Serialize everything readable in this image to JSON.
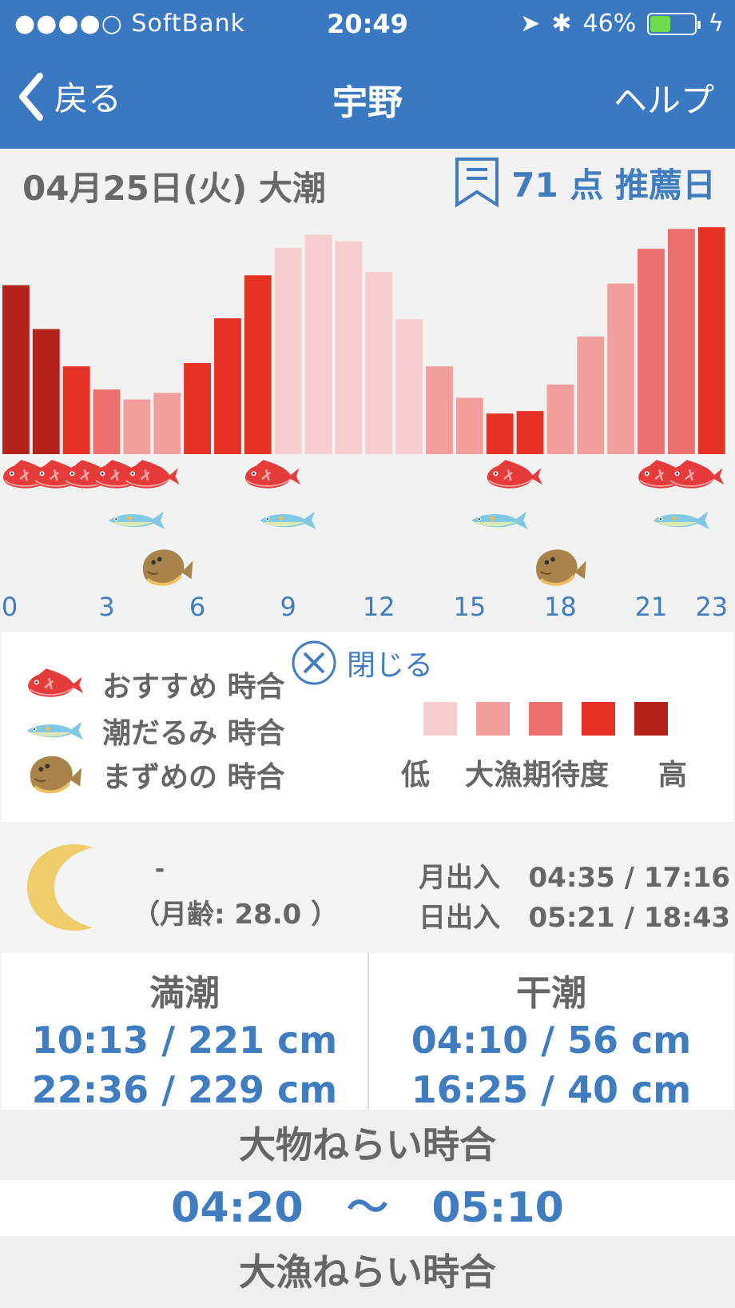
{
  "status": {
    "carrier": "●●●●○ SoftBank",
    "time": "20:49",
    "battery": "46%",
    "battery_level": 0.46
  },
  "nav": {
    "back": "戻る",
    "title": "宇野",
    "help": "ヘルプ"
  },
  "header": {
    "date": "04月25日(火) 大潮",
    "score": "71 点 推薦日"
  },
  "chart_data": {
    "type": "bar",
    "title": "",
    "xlabel": "",
    "ylabel": "",
    "x_ticks": [
      "0",
      "3",
      "6",
      "9",
      "12",
      "15",
      "18",
      "21",
      "23"
    ],
    "categories": [
      0,
      1,
      2,
      3,
      4,
      5,
      6,
      7,
      8,
      9,
      10,
      11,
      12,
      13,
      14,
      15,
      16,
      17,
      18,
      19,
      20,
      21,
      22,
      23
    ],
    "values": [
      204,
      151,
      106,
      78,
      66,
      74,
      110,
      164,
      216,
      249,
      265,
      257,
      220,
      163,
      106,
      68,
      49,
      52,
      84,
      142,
      206,
      248,
      272,
      274
    ],
    "expectation_level": [
      5,
      5,
      4,
      3,
      2,
      2,
      4,
      4,
      4,
      1,
      1,
      1,
      1,
      1,
      2,
      2,
      4,
      4,
      2,
      2,
      2,
      3,
      3,
      4
    ],
    "level_colors": [
      "#f7cdd0",
      "#f29e9d",
      "#ec6f6b",
      "#e63225",
      "#b5221c"
    ],
    "recommended_hours": [
      0,
      1,
      2,
      3,
      4,
      8,
      16,
      21,
      22
    ],
    "slack_tide_hours": [
      4,
      9,
      16,
      22
    ],
    "twilight_hours": [
      5,
      18
    ]
  },
  "legend": {
    "close": "閉じる",
    "items": [
      {
        "icon": "red-snapper-icon",
        "label": "おすすめ 時合"
      },
      {
        "icon": "mackerel-icon",
        "label": "潮だるみ 時合"
      },
      {
        "icon": "flounder-icon",
        "label": "まずめの 時合"
      }
    ],
    "scale_low": "低",
    "scale_title": "大漁期待度",
    "scale_high": "高"
  },
  "moon": {
    "phase": "-",
    "age": "（月齢: 28.0 ）",
    "moon_label": "月出入",
    "moon_times": "04:35 / 17:16",
    "sun_label": "日出入",
    "sun_times": "05:21 / 18:43"
  },
  "tide": {
    "high_title": "満潮",
    "high": [
      "10:13 / 221 cm",
      "22:36 / 229 cm"
    ],
    "low_title": "干潮",
    "low": [
      "04:10 / 56 cm",
      "16:25 / 40 cm"
    ]
  },
  "big_game": {
    "title": "大物ねらい時合",
    "start": "04:20",
    "sep": "〜",
    "end": "05:10"
  },
  "big_catch": {
    "title": "大漁ねらい時合"
  }
}
